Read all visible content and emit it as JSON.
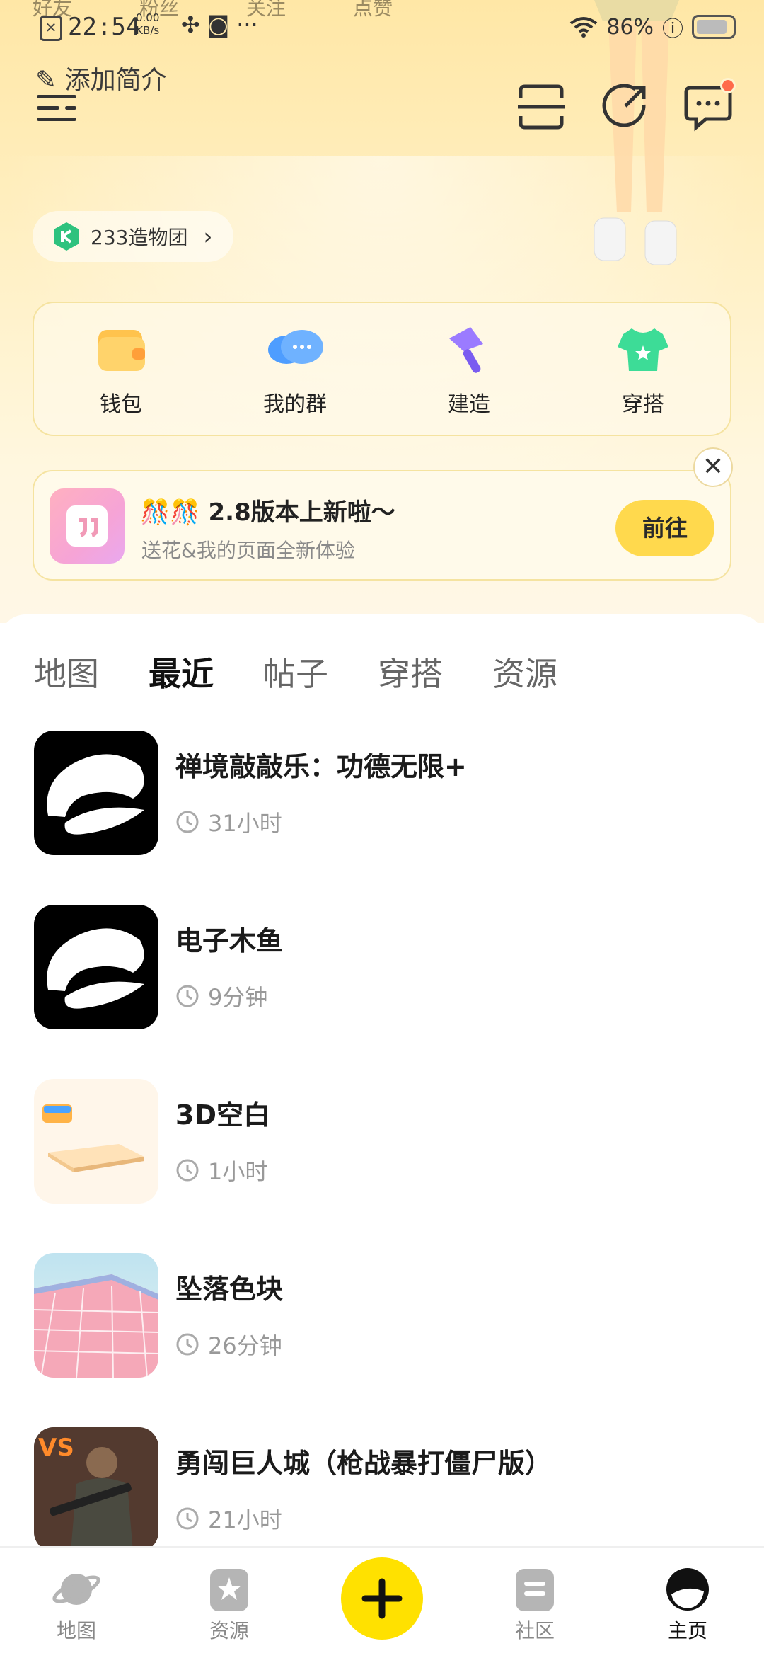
{
  "status_bar": {
    "time": "22:54",
    "speed_value": "0.00",
    "speed_unit": "KB/s",
    "battery": "86%",
    "ghost_labels": [
      "好友",
      "粉丝",
      "关注",
      "点赞"
    ]
  },
  "profile": {
    "add_intro": "添加简介",
    "club_label": "233造物团"
  },
  "quick_actions": [
    {
      "label": "钱包",
      "icon": "wallet-icon"
    },
    {
      "label": "我的群",
      "icon": "group-chat-icon"
    },
    {
      "label": "建造",
      "icon": "build-hammer-icon"
    },
    {
      "label": "穿搭",
      "icon": "outfit-tshirt-icon"
    }
  ],
  "banner": {
    "emoji": "🎊🎊",
    "title": "2.8版本上新啦～",
    "subtitle": "送花&我的页面全新体验",
    "button": "前往"
  },
  "tabs": [
    {
      "label": "地图",
      "active": false
    },
    {
      "label": "最近",
      "active": true
    },
    {
      "label": "帖子",
      "active": false
    },
    {
      "label": "穿搭",
      "active": false
    },
    {
      "label": "资源",
      "active": false
    }
  ],
  "recent_items": [
    {
      "title": "禅境敲敲乐：功德无限+",
      "time": "31小时"
    },
    {
      "title": "电子木鱼",
      "time": "9分钟"
    },
    {
      "title": "3D空白",
      "time": "1小时"
    },
    {
      "title": "坠落色块",
      "time": "26分钟"
    },
    {
      "title": "勇闯巨人城（枪战暴打僵尸版）",
      "time": "21小时"
    }
  ],
  "bottom_nav": [
    {
      "label": "地图",
      "active": false
    },
    {
      "label": "资源",
      "active": false
    },
    {
      "label": "社区",
      "active": false
    },
    {
      "label": "主页",
      "active": true
    }
  ],
  "colors": {
    "accent_yellow": "#ffd94d",
    "plus_yellow": "#ffe100",
    "notification_dot": "#ff6a4a"
  }
}
